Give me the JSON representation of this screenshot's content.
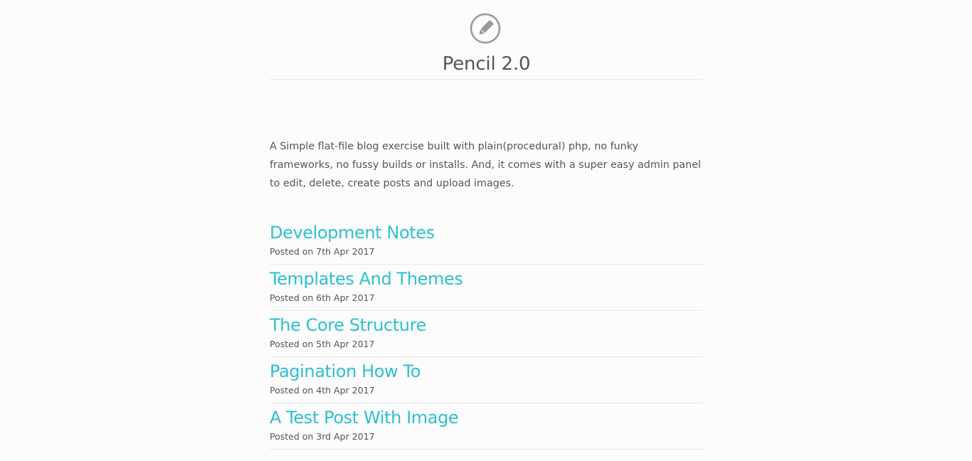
{
  "header": {
    "logo_icon": "pencil-circle-icon",
    "title": "Pencil 2.0"
  },
  "intro": {
    "text": "A Simple flat-file blog exercise built with plain(procedural) php, no funky frameworks, no fussy builds or installs. And, it comes with a super easy admin panel to edit, delete, create posts and upload images."
  },
  "colors": {
    "link": "#2ec0cf",
    "text": "#555555",
    "divider": "#e8e8e8",
    "background": "#fcfcfc",
    "logo": "#999999"
  },
  "posts": [
    {
      "title": "Development Notes",
      "meta": "Posted on 7th Apr 2017"
    },
    {
      "title": "Templates And Themes",
      "meta": "Posted on 6th Apr 2017"
    },
    {
      "title": "The Core Structure",
      "meta": "Posted on 5th Apr 2017"
    },
    {
      "title": "Pagination How To",
      "meta": "Posted on 4th Apr 2017"
    },
    {
      "title": "A Test Post With Image",
      "meta": "Posted on 3rd Apr 2017"
    }
  ]
}
